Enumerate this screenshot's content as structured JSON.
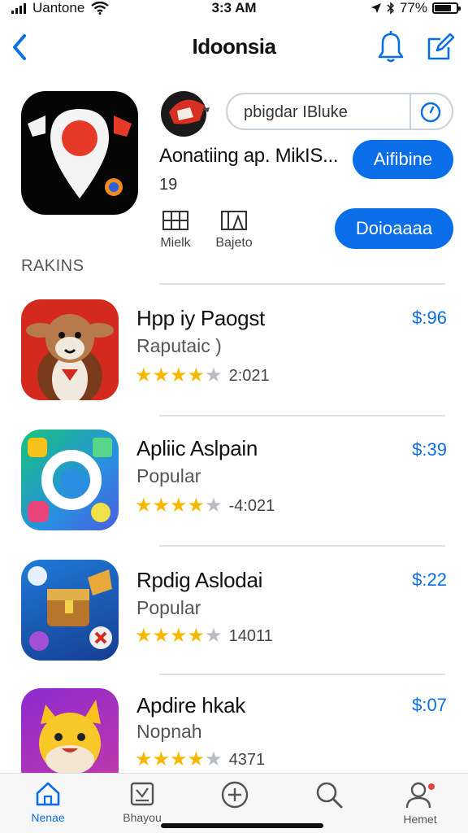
{
  "status_bar": {
    "carrier": "Uantone",
    "time": "3:3 AM",
    "battery": "77%",
    "battery_level": 0.77,
    "icons": [
      "signal-icon",
      "wifi-icon",
      "location-icon",
      "bluetooth-icon",
      "battery-icon"
    ]
  },
  "nav": {
    "title": "Idoonsia",
    "icons": [
      "back-chevron-icon",
      "bell-icon",
      "compose-icon"
    ]
  },
  "featured": {
    "search_placeholder": "pbigdar IBluke",
    "name": "Aonatiing ap. MikIS...",
    "count": "19",
    "primary_button": "Aifibine",
    "secondary_button": "Doioaaaa",
    "actions": [
      {
        "label": "Mielk",
        "icon": "grid-icon"
      },
      {
        "label": "Bajeto",
        "icon": "layout-icon"
      }
    ]
  },
  "section": {
    "label": "RAKINS"
  },
  "apps": [
    {
      "name": "Hpp iy Paogst",
      "subtitle": "Raputaic )",
      "rating": 4.5,
      "rating_count": "2:021",
      "price": "$:96",
      "icon": "cartoon-cow-app-icon"
    },
    {
      "name": "Apliic Aslpain",
      "subtitle": "Popular",
      "rating": 4.5,
      "rating_count": "-4:021",
      "price": "$:39",
      "icon": "circular-sync-app-icon"
    },
    {
      "name": "Rpdig Aslodai",
      "subtitle": "Popular",
      "rating": 4.5,
      "rating_count": "14011",
      "price": "$:22",
      "icon": "treasure-game-app-icon"
    },
    {
      "name": "Apdire hkak",
      "subtitle": "Nopnah",
      "rating": 4.5,
      "rating_count": "4371",
      "price": "$:07",
      "icon": "chick-character-app-icon"
    }
  ],
  "tab_bar": {
    "tabs": [
      {
        "label": "Nenae",
        "icon": "home-icon",
        "active": true
      },
      {
        "label": "Bhayou",
        "icon": "news-icon",
        "active": false
      },
      {
        "label": "",
        "icon": "plus-circle-icon",
        "active": false
      },
      {
        "label": "",
        "icon": "search-icon",
        "active": false
      },
      {
        "label": "Hemet",
        "icon": "profile-icon",
        "active": false
      }
    ]
  },
  "colors": {
    "accent": "#0a6ee8",
    "star": "#f5b800",
    "divider": "#dde1e6"
  }
}
